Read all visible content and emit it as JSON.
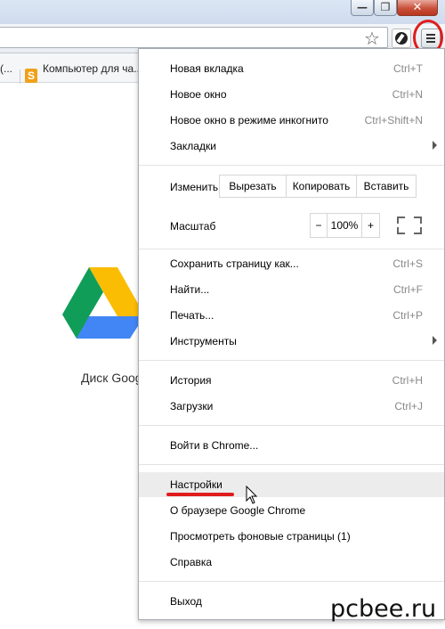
{
  "window": {
    "min_glyph": "—",
    "max_glyph": "❐",
    "close_glyph": "✕"
  },
  "bookmarks": [
    {
      "label": "(..."
    },
    {
      "label": "Компьютер для ча..."
    }
  ],
  "bookmark_icon_letter": "S",
  "page": {
    "drive_label": "Диск Google"
  },
  "menu": {
    "items_top": [
      {
        "label": "Новая вкладка",
        "shortcut": "Ctrl+T"
      },
      {
        "label": "Новое окно",
        "shortcut": "Ctrl+N"
      },
      {
        "label": "Новое окно в режиме инкогнито",
        "shortcut": "Ctrl+Shift+N"
      },
      {
        "label": "Закладки",
        "shortcut": "",
        "submenu": true
      }
    ],
    "edit": {
      "label": "Изменить",
      "cut": "Вырезать",
      "copy": "Копировать",
      "paste": "Вставить"
    },
    "zoom": {
      "label": "Масштаб",
      "minus": "−",
      "value": "100%",
      "plus": "+"
    },
    "items_mid": [
      {
        "label": "Сохранить страницу как...",
        "shortcut": "Ctrl+S"
      },
      {
        "label": "Найти...",
        "shortcut": "Ctrl+F"
      },
      {
        "label": "Печать...",
        "shortcut": "Ctrl+P"
      },
      {
        "label": "Инструменты",
        "shortcut": "",
        "submenu": true
      }
    ],
    "items_hist": [
      {
        "label": "История",
        "shortcut": "Ctrl+H"
      },
      {
        "label": "Загрузки",
        "shortcut": "Ctrl+J"
      }
    ],
    "signin": "Войти в Chrome...",
    "items_settings": [
      {
        "label": "Настройки"
      },
      {
        "label": "О браузере Google Chrome"
      },
      {
        "label": "Просмотреть фоновые страницы (1)"
      },
      {
        "label": "Справка"
      }
    ],
    "exit": "Выход"
  },
  "watermark": "pcbee.ru",
  "colors": {
    "highlight_red": "#e01c1c",
    "menu_hover": "#ececec"
  }
}
